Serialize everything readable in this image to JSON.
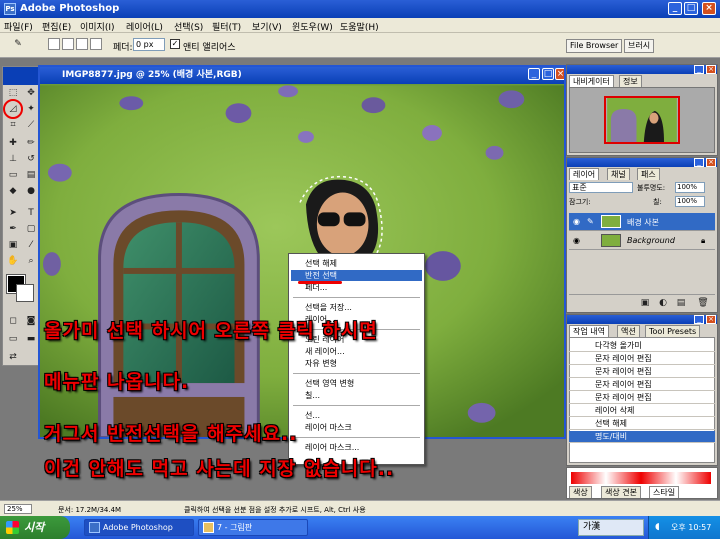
{
  "window": {
    "title": "Adobe Photoshop"
  },
  "menu": [
    "파일(F)",
    "편집(E)",
    "이미지(I)",
    "레이어(L)",
    "선택(S)",
    "필터(T)",
    "보기(V)",
    "윈도우(W)",
    "도움말(H)"
  ],
  "options": {
    "feather_label": "페더:",
    "feather_value": "0 px",
    "antialias_label": "앤티 앨리어스",
    "well_tabs": [
      "File Browser",
      "브러시"
    ]
  },
  "document": {
    "title": "IMGP8877.jpg @ 25% (배경 사본,RGB)"
  },
  "context_menu": {
    "items": [
      "선택 해제",
      "반전 선택",
      "페더...",
      "선택을 저장...",
      "레이어 ...",
      "오린 레이어",
      "새 레이어...",
      "자유 변형",
      "선택 영역 변형",
      "칠...",
      "선...",
      "레이어 마스크",
      "레이어 마스크..."
    ],
    "selected_index": 1
  },
  "captions": [
    "올가미 선택 하시어 오른쪽 클릭 하시면",
    "메뉴판 나옵니다.",
    "거그서 반전선택을 해주세요..",
    "이건 안해도 먹고 사는데 지장 없습니다.."
  ],
  "navigator": {
    "tabs": [
      "내비게이터",
      "정보"
    ]
  },
  "layers": {
    "tabs": [
      "레이어",
      "채널",
      "패스"
    ],
    "blend_mode": "표준",
    "opacity_label": "불투명도:",
    "opacity_value": "100%",
    "fill_label": "칠:",
    "fill_value": "100%",
    "lock_label": "잠그기:",
    "rows": [
      {
        "name": "배경 사본",
        "selected": true
      },
      {
        "name": "Background",
        "selected": false
      }
    ]
  },
  "history": {
    "tabs": [
      "작업 내역",
      "액션",
      "Tool Presets"
    ],
    "rows": [
      "다각형 올가미",
      "문자 레이어 편집",
      "문자 레이어 편집",
      "문자 레이어 편집",
      "문자 레이어 편집",
      "레이어 삭제",
      "선택 해제",
      "명도/대비"
    ]
  },
  "bottom_panel": {
    "tabs": [
      "색상",
      "색상 견본",
      "스타일"
    ]
  },
  "status": {
    "zoom": "25%",
    "doc": "문서: 17.2M/34.4M",
    "hint": "클릭하여 선택을 선분 점을 설정 추가로 시프트, Alt, Ctrl 사용"
  },
  "taskbar": {
    "start": "시작",
    "tasks": [
      "Adobe Photoshop",
      "7 - 그림판"
    ],
    "ime": "가漢",
    "clock": "오후 10:57"
  },
  "colors": {
    "xp_blue": "#0a3fb6",
    "selection": "#316ac5",
    "caption_red": "#ee0000",
    "wall_green": "#7fae3e"
  }
}
